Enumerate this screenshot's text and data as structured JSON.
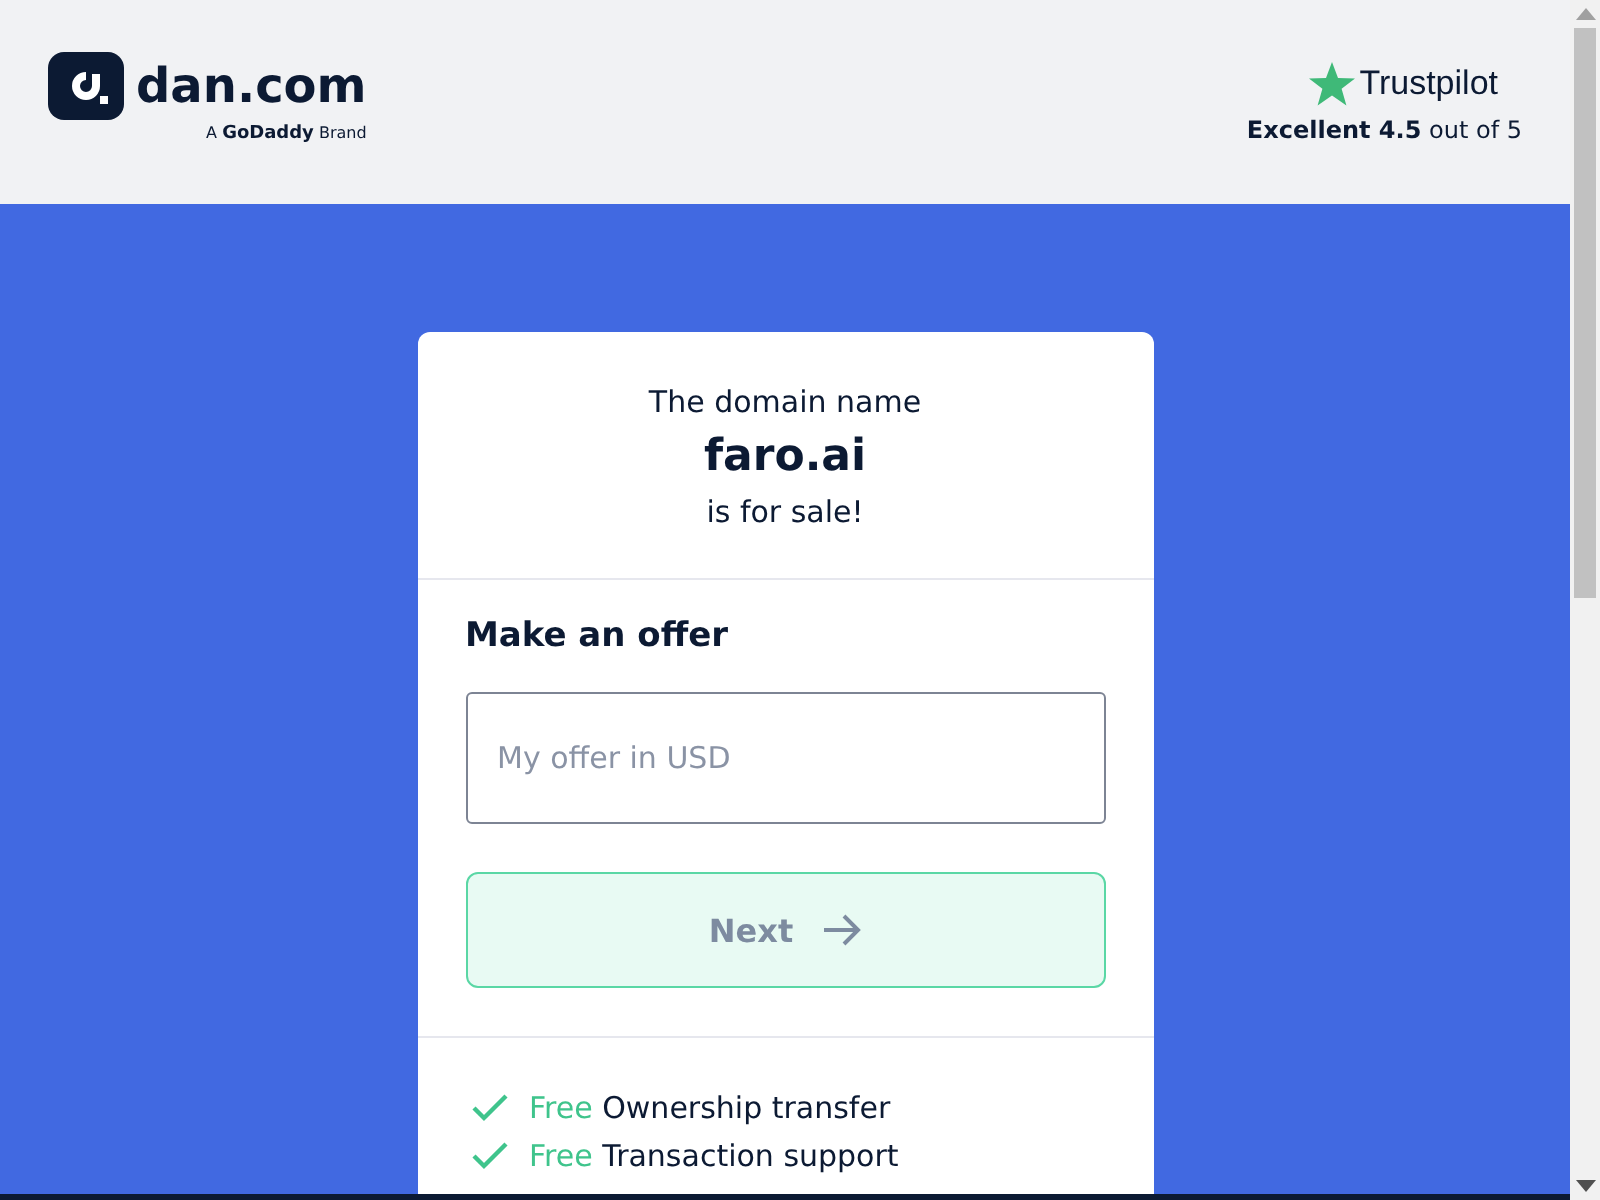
{
  "header": {
    "logo": {
      "name": "dan.com",
      "tagline_prefix": "A",
      "tagline_brand": "GoDaddy",
      "tagline_suffix": "Brand"
    },
    "rating": {
      "brand": "Trustpilot",
      "summary": "**Excellent 4.5** out of 5"
    }
  },
  "card": {
    "intro": "The domain name",
    "domain": "faro.ai",
    "outro": "is for sale!",
    "offer": {
      "title": "Make an offer",
      "input": {
        "placeholder": "My offer in USD"
      },
      "button": {
        "label": "Next",
        "disabled": true
      }
    },
    "features": [
      {
        "tag": "Free",
        "text": "Ownership transfer"
      },
      {
        "tag": "Free",
        "text": "Transaction support"
      }
    ]
  }
}
